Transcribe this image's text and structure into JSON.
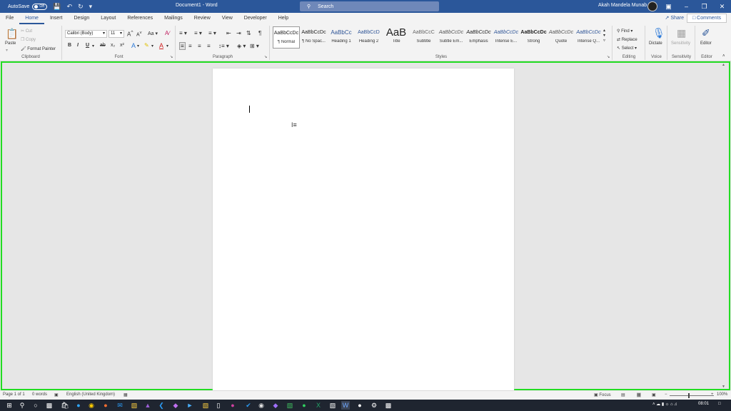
{
  "titlebar": {
    "autosave_label": "AutoSave",
    "autosave_state": "Off",
    "doc_title": "Document1 - Word",
    "search_placeholder": "Search",
    "user_name": "Akah Mandela Munab"
  },
  "tabs": [
    "File",
    "Home",
    "Insert",
    "Design",
    "Layout",
    "References",
    "Mailings",
    "Review",
    "View",
    "Developer",
    "Help"
  ],
  "active_tab": "Home",
  "share_label": "Share",
  "comments_label": "Comments",
  "clipboard": {
    "paste": "Paste",
    "cut": "Cut",
    "copy": "Copy",
    "format_painter": "Format Painter",
    "label": "Clipboard"
  },
  "font": {
    "family": "Calibri (Body)",
    "size": "11",
    "label": "Font",
    "bold": "B",
    "italic": "I",
    "underline": "U",
    "strike": "ab",
    "subscript": "x₂",
    "superscript": "x²",
    "change_case": "Aa"
  },
  "paragraph": {
    "label": "Paragraph"
  },
  "styles": {
    "label": "Styles",
    "items": [
      {
        "preview": "AaBbCcDc",
        "name": "¶ Normal"
      },
      {
        "preview": "AaBbCcDc",
        "name": "¶ No Spac..."
      },
      {
        "preview": "AaBbCc",
        "name": "Heading 1"
      },
      {
        "preview": "AaBbCcD",
        "name": "Heading 2"
      },
      {
        "preview": "AaB",
        "name": "Title"
      },
      {
        "preview": "AaBbCcC",
        "name": "Subtitle"
      },
      {
        "preview": "AaBbCcDc",
        "name": "Subtle Em..."
      },
      {
        "preview": "AaBbCcDc",
        "name": "Emphasis"
      },
      {
        "preview": "AaBbCcDc",
        "name": "Intense E..."
      },
      {
        "preview": "AaBbCcDc",
        "name": "Strong"
      },
      {
        "preview": "AaBbCcDc",
        "name": "Quote"
      },
      {
        "preview": "AaBbCcDc",
        "name": "Intense Q..."
      }
    ]
  },
  "editing": {
    "find": "Find",
    "replace": "Replace",
    "select": "Select",
    "label": "Editing"
  },
  "voice": {
    "dictate": "Dictate",
    "label": "Voice"
  },
  "sensitivity": {
    "button": "Sensitivity",
    "label": "Sensitivity"
  },
  "editor": {
    "button": "Editor",
    "label": "Editor"
  },
  "statusbar": {
    "page": "Page 1 of 1",
    "words": "0 words",
    "language": "English (United Kingdom)",
    "focus": "Focus",
    "zoom": "100%"
  },
  "taskbar": {
    "time": "08:01"
  },
  "colors": {
    "accent": "#2b579a",
    "highlight_border": "#22dd22"
  }
}
